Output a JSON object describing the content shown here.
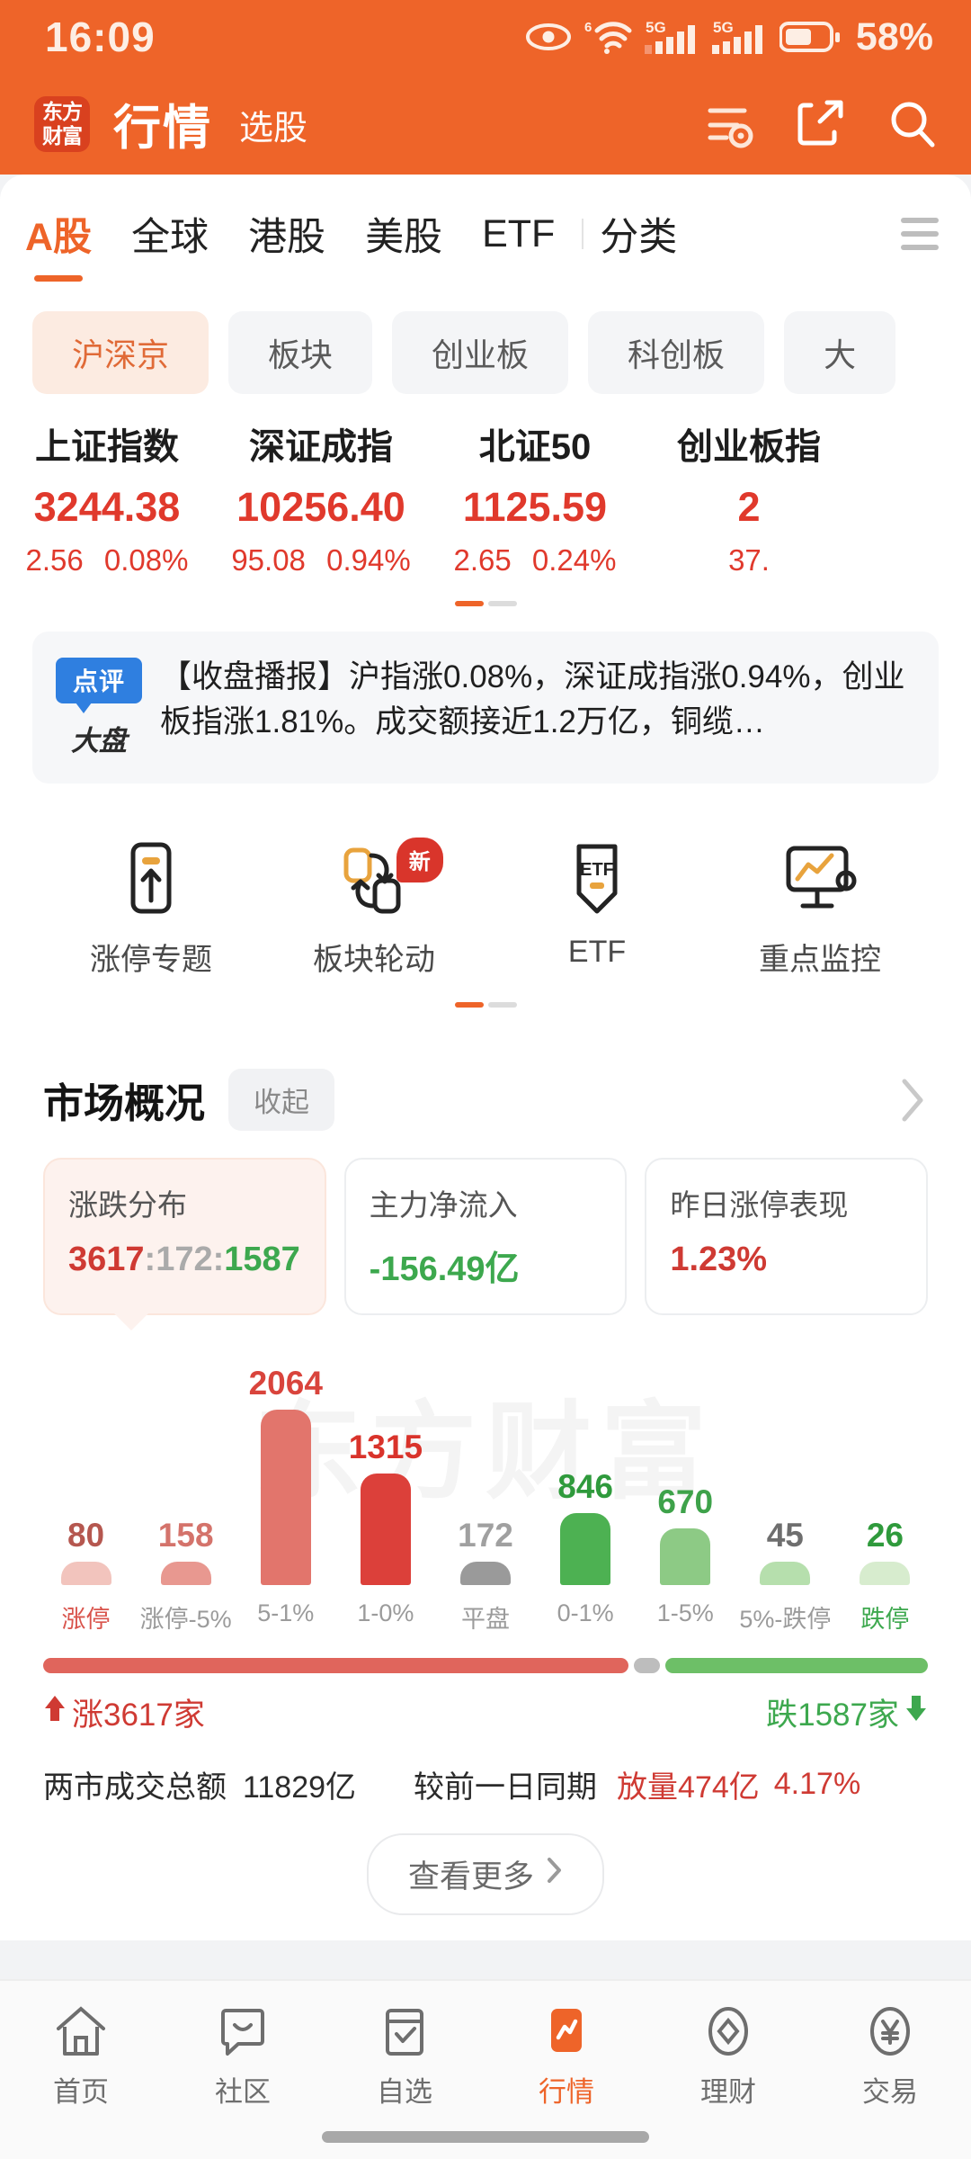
{
  "status_bar": {
    "time": "16:09",
    "battery_percent": "58%",
    "icons": [
      "eye-icon",
      "wifi-6-icon",
      "signal-5g-icon",
      "signal-5g-icon-2",
      "battery-icon"
    ]
  },
  "header": {
    "logo_line1": "东方",
    "logo_line2": "财富",
    "title": "行情",
    "subtitle": "选股",
    "actions": [
      "filter-settings-icon",
      "share-icon",
      "search-icon"
    ]
  },
  "tabs": [
    {
      "label": "A股",
      "active": true
    },
    {
      "label": "全球",
      "active": false
    },
    {
      "label": "港股",
      "active": false
    },
    {
      "label": "美股",
      "active": false
    },
    {
      "label": "ETF",
      "active": false
    },
    {
      "label": "分类",
      "active": false
    }
  ],
  "chips": [
    {
      "label": "沪深京",
      "active": true
    },
    {
      "label": "板块",
      "active": false
    },
    {
      "label": "创业板",
      "active": false
    },
    {
      "label": "科创板",
      "active": false
    },
    {
      "label": "大",
      "active": false
    }
  ],
  "indices": [
    {
      "name": "上证指数",
      "value": "3244.38",
      "change": "2.56",
      "percent": "0.08%"
    },
    {
      "name": "深证成指",
      "value": "10256.40",
      "change": "95.08",
      "percent": "0.94%"
    },
    {
      "name": "北证50",
      "value": "1125.59",
      "change": "2.65",
      "percent": "0.24%"
    },
    {
      "name": "创业板指",
      "value": "2",
      "change": "37.",
      "percent": ""
    }
  ],
  "news": {
    "badge_top": "点评",
    "badge_bottom": "大盘",
    "text": "【收盘播报】沪指涨0.08%，深证成指涨0.94%，创业板指涨1.81%。成交额接近1.2万亿，铜缆…"
  },
  "quick_links": [
    {
      "label": "涨停专题",
      "icon": "limit-up-topic-icon",
      "badge": ""
    },
    {
      "label": "板块轮动",
      "icon": "sector-rotation-icon",
      "badge": "新"
    },
    {
      "label": "ETF",
      "icon": "etf-icon",
      "badge": ""
    },
    {
      "label": "重点监控",
      "icon": "key-monitor-icon",
      "badge": ""
    }
  ],
  "market": {
    "title": "市场概况",
    "collapse_label": "收起",
    "stats": [
      {
        "label": "涨跌分布",
        "up": "3617",
        "flat": "172",
        "down": "1587",
        "selected": true
      },
      {
        "label": "主力净流入",
        "value": "-156.49亿",
        "tone": "down",
        "selected": false
      },
      {
        "label": "昨日涨停表现",
        "value": "1.23%",
        "tone": "up",
        "selected": false
      }
    ],
    "ratio": {
      "up_label": "涨3617家",
      "down_label": "跌1587家",
      "up_pct": 67,
      "flat_pct": 3,
      "down_pct": 30
    },
    "turnover_label": "两市成交总额",
    "turnover_value": "11829亿",
    "compare_label": "较前一日同期",
    "compare_value": "放量474亿",
    "compare_percent": "4.17%",
    "more_label": "查看更多",
    "watermark": "东方财富"
  },
  "chart_data": {
    "type": "bar",
    "title": "涨跌分布",
    "categories": [
      "涨停",
      "涨停-5%",
      "5-1%",
      "1-0%",
      "平盘",
      "0-1%",
      "1-5%",
      "5%-跌停",
      "跌停"
    ],
    "values": [
      80,
      158,
      2064,
      1315,
      172,
      846,
      670,
      45,
      26
    ],
    "colors": [
      "#f2c4bd",
      "#e89890",
      "#e2756c",
      "#dc403a",
      "#9a9a9a",
      "#4db152",
      "#8dca85",
      "#b6dfad",
      "#d7ecce"
    ],
    "label_colors": [
      "#b5574f",
      "#d4736b",
      "#d9443c",
      "#d9332b",
      "#a0a0a0",
      "#2f9a3c",
      "#3ea24a",
      "#6e6e6e",
      "#2f9a3c"
    ],
    "xlabel": "",
    "ylabel": "",
    "ylim": [
      0,
      2064
    ],
    "grid": false,
    "legend": "none"
  },
  "bottom_nav": [
    {
      "label": "首页",
      "icon": "home-icon",
      "active": false
    },
    {
      "label": "社区",
      "icon": "community-icon",
      "active": false
    },
    {
      "label": "自选",
      "icon": "watchlist-icon",
      "active": false
    },
    {
      "label": "行情",
      "icon": "quotes-icon",
      "active": true
    },
    {
      "label": "理财",
      "icon": "finance-icon",
      "active": false
    },
    {
      "label": "交易",
      "icon": "trade-icon",
      "active": false
    }
  ],
  "colors": {
    "brand": "#ee6429",
    "up": "#cf3a33",
    "down": "#3da84e",
    "flat": "#9a9a9a"
  }
}
